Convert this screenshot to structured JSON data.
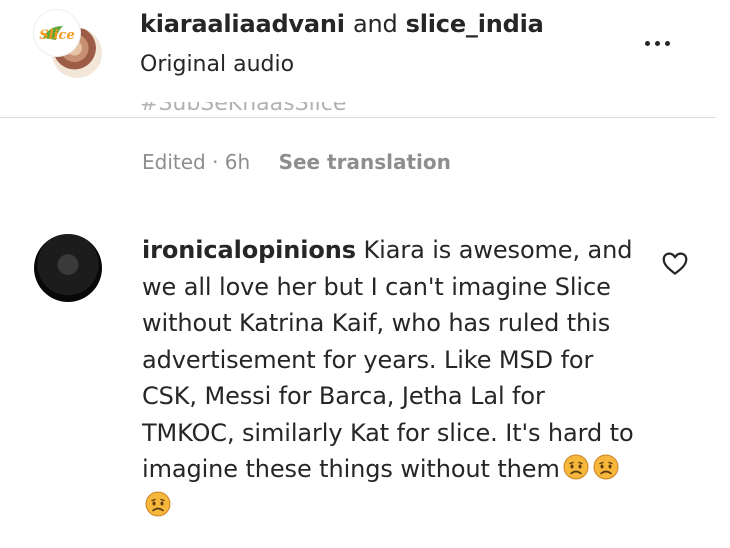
{
  "post": {
    "author_primary": "kiaraaliaadvani",
    "joiner": "and",
    "author_secondary": "slice_india",
    "audio": "Original audio",
    "clipped_caption": "#SubSeKhaasSlice",
    "meta_edited": "Edited · 6h",
    "see_translation": "See translation",
    "avatar_badge_text": "Slice"
  },
  "comment": {
    "username": "ironicalopinions",
    "text": "Kiara is awesome, and we all love her but I can't imagine Slice without Katrina Kaif, who has ruled this advertisement for years. Like MSD for CSK, Messi for Barca, Jetha Lal for TMKOC, similarly Kat for slice. It's hard to imagine these things without them",
    "emoji_count": 3
  },
  "icons": {
    "more": "more-options-icon",
    "like": "heart-outline-icon",
    "emoji": "sad-face-emoji-icon"
  },
  "colors": {
    "text_primary": "#262626",
    "text_secondary": "#8e8e8e",
    "divider": "#dbdbdb",
    "emoji_face": "#f6b73b"
  }
}
